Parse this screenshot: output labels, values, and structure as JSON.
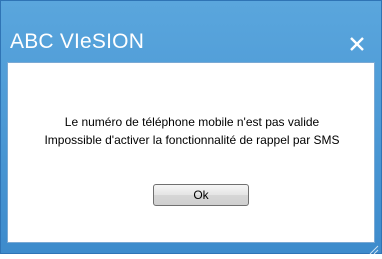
{
  "dialog": {
    "title": "ABC VIeSION",
    "close_label": "✕",
    "message_line1": "Le numéro de téléphone mobile n'est pas valide",
    "message_line2": "Impossible d'activer la fonctionnalité de rappel par SMS",
    "ok_label": "Ok"
  },
  "colors": {
    "titlebar_top": "#5aa6dd",
    "titlebar_bottom": "#3d8bcc",
    "border": "#2f74b5",
    "content_bg": "#ffffff"
  },
  "icons": {
    "close": "close-icon",
    "resize": "resize-grip-icon"
  }
}
